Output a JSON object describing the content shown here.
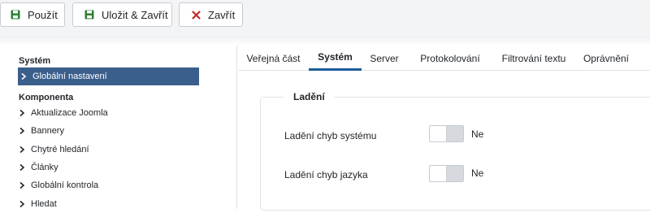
{
  "toolbar": {
    "use_label": "Použít",
    "save_close_label": "Uložit & Zavřít",
    "close_label": "Zavřít",
    "use_icon": "floppy-disk-icon",
    "save_close_icon": "floppy-disk-icon",
    "close_icon": "x-icon",
    "save_icon_color": "#2f7d32",
    "close_icon_color": "#c52827"
  },
  "sidebar": {
    "section1_title": "Systém",
    "active_item": "Globální nastavení",
    "section2_title": "Komponenta",
    "items": [
      "Aktualizace Joomla",
      "Bannery",
      "Chytré hledání",
      "Články",
      "Globální kontrola",
      "Hledat"
    ],
    "active_color": "#3b5f8c"
  },
  "tabs": {
    "items": [
      "Veřejná část",
      "Systém",
      "Server",
      "Protokolování",
      "Filtrování textu",
      "Oprávnění"
    ],
    "active": "Systém",
    "active_color": "#1f5c9a"
  },
  "panel": {
    "legend": "Ladění",
    "fields": [
      {
        "label": "Ladění chyb systému",
        "value": "Ne"
      },
      {
        "label": "Ladění chyb jazyka",
        "value": "Ne"
      }
    ]
  }
}
